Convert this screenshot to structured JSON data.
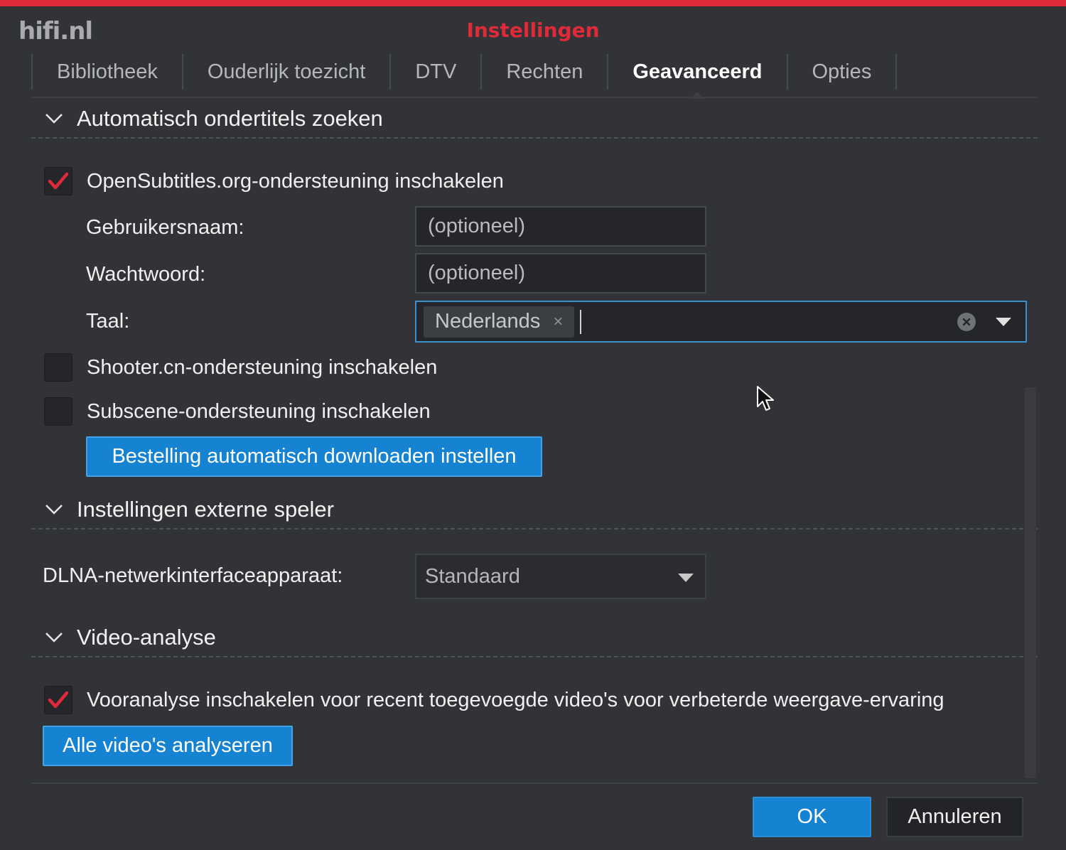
{
  "watermark": "hifi.nl",
  "dialog": {
    "title": "Instellingen"
  },
  "tabs": [
    {
      "label": "Bibliotheek"
    },
    {
      "label": "Ouderlijk toezicht"
    },
    {
      "label": "DTV"
    },
    {
      "label": "Rechten"
    },
    {
      "label": "Geavanceerd",
      "active": true
    },
    {
      "label": "Opties"
    }
  ],
  "subtitles": {
    "title": "Automatisch ondertitels zoeken",
    "opensubtitles": {
      "label": "OpenSubtitles.org-ondersteuning inschakelen",
      "checked": true
    },
    "username": {
      "label": "Gebruikersnaam:",
      "placeholder": "(optioneel)",
      "value": ""
    },
    "password": {
      "label": "Wachtwoord:",
      "placeholder": "(optioneel)",
      "value": ""
    },
    "language": {
      "label": "Taal:",
      "selected": [
        "Nederlands"
      ],
      "remove_glyph": "×"
    },
    "shooter": {
      "label": "Shooter.cn-ondersteuning inschakelen",
      "checked": false
    },
    "subscene": {
      "label": "Subscene-ondersteuning inschakelen",
      "checked": false
    },
    "order_button": "Bestelling automatisch downloaden instellen"
  },
  "external_player": {
    "title": "Instellingen externe speler",
    "dlna_label": "DLNA-netwerkinterfaceapparaat:",
    "dlna_value": "Standaard"
  },
  "video_analysis": {
    "title": "Video-analyse",
    "preanalysis": {
      "label": "Vooranalyse inschakelen voor recent toegevoegde video's voor verbeterde weergave-ervaring",
      "checked": true
    },
    "analyze_all_button": "Alle video's analyseren"
  },
  "footer": {
    "ok": "OK",
    "cancel": "Annuleren"
  },
  "colors": {
    "accent_red": "#e02a3a",
    "button_blue": "#1683d2",
    "focus_blue": "#3a8fd0",
    "background": "#313336"
  },
  "icons": [
    "chevron-down-icon",
    "checkmark-icon",
    "clear-icon",
    "dropdown-arrow-icon",
    "mouse-cursor-icon"
  ]
}
